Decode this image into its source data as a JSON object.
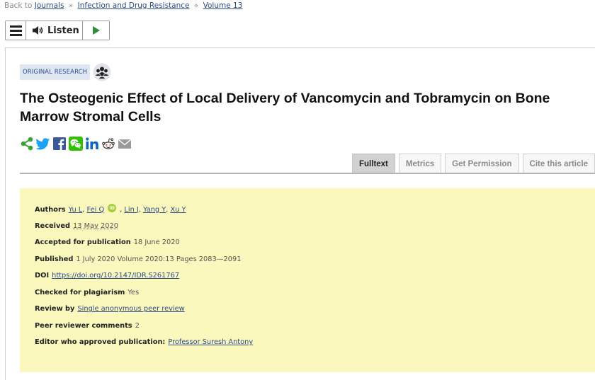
{
  "breadcrumb": {
    "prefix": "Back to",
    "items": [
      "Journals",
      "Infection and Drug Resistance",
      "Volume 13"
    ],
    "separator": "»"
  },
  "listen": {
    "label": "Listen",
    "icons": [
      "menu-icon",
      "speaker-icon",
      "play-icon"
    ]
  },
  "article": {
    "type_tag": "ORIGINAL RESEARCH",
    "title": "The Osteogenic Effect of Local Delivery of Vancomycin and Tobramycin on Bone Marrow Stromal Cells"
  },
  "social_icons": [
    "share-icon",
    "twitter-icon",
    "facebook-icon",
    "wechat-icon",
    "linkedin-icon",
    "reddit-icon",
    "email-icon"
  ],
  "tabs": [
    {
      "label": "Fulltext",
      "active": true
    },
    {
      "label": "Metrics",
      "active": false
    },
    {
      "label": "Get Permission",
      "active": false
    },
    {
      "label": "Cite this article",
      "active": false
    }
  ],
  "info": {
    "authors_label": "Authors",
    "authors": [
      "Yu L",
      "Fei Q",
      "Lin J",
      "Yang Y",
      "Xu Y"
    ],
    "orcid_mark": "iD",
    "received_label": "Received",
    "received_value": "13 May 2020",
    "accepted_label": "Accepted for publication",
    "accepted_value": "18 June 2020",
    "published_label": "Published",
    "published_value": "1 July 2020 Volume 2020:13 Pages 2083—2091",
    "doi_label": "DOI",
    "doi_value": "https://doi.org/10.2147/IDR.S261767",
    "plagiarism_label": "Checked for plagiarism",
    "plagiarism_value": "Yes",
    "review_label": "Review by",
    "review_value": "Single anonymous peer review",
    "comments_label": "Peer reviewer comments",
    "comments_value": "2",
    "editor_label": "Editor who approved publication:",
    "editor_value": "Professor Suresh Antony"
  },
  "colors": {
    "link": "#2a4a8a",
    "info_background": "#fbf8bd",
    "tag_background": "#dfe7f3",
    "share_green": "#3aa335",
    "play_green": "#2e8b3d"
  }
}
